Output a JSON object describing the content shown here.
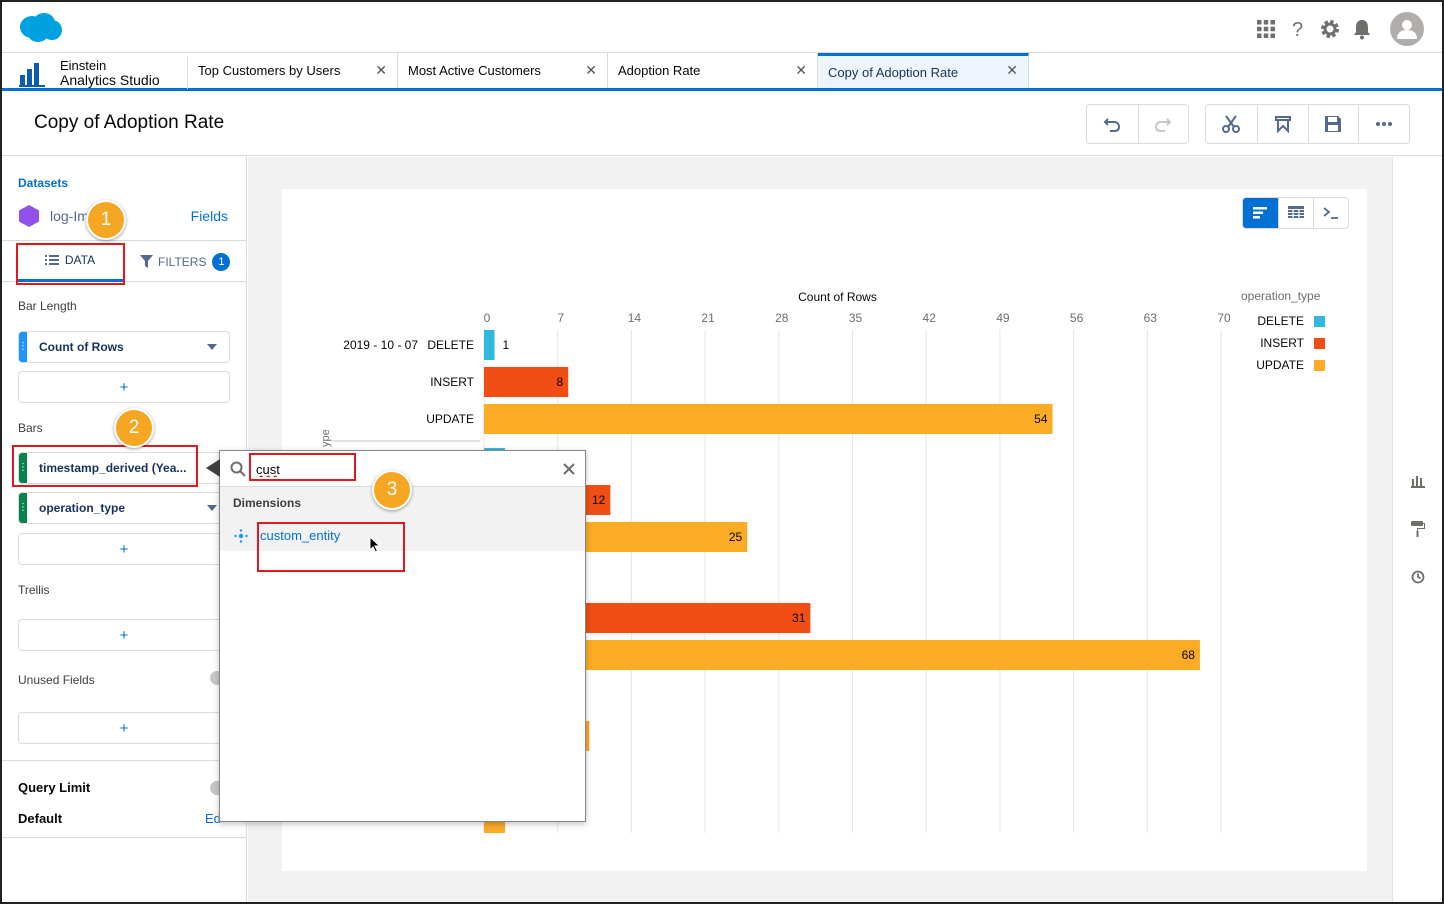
{
  "app": {
    "brand_line1": "Einstein",
    "brand_line2": "Analytics Studio"
  },
  "tabs": [
    {
      "label": "Top Customers by Users"
    },
    {
      "label": "Most Active Customers"
    },
    {
      "label": "Adoption Rate"
    },
    {
      "label": "Copy of Adoption Rate",
      "active": true
    }
  ],
  "page": {
    "title": "Copy of Adoption Rate"
  },
  "toolbar_icons": [
    "undo-icon",
    "redo-icon",
    "cut-icon",
    "clear-icon",
    "save-icon",
    "more-icon"
  ],
  "left_panel": {
    "datasets_label": "Datasets",
    "dataset_name": "log-Im",
    "fields_link": "Fields",
    "tab_data": "DATA",
    "tab_filters": "FILTERS",
    "filters_count": "1",
    "bar_length_label": "Bar Length",
    "bar_length_field": "Count of Rows",
    "bars_label": "Bars",
    "bars_fields": [
      "timestamp_derived (Yea...",
      "operation_type"
    ],
    "trellis_label": "Trellis",
    "unused_label": "Unused Fields",
    "add_symbol": "+",
    "query_limit_label": "Query Limit",
    "default_label": "Default",
    "edit_link": "Ed"
  },
  "search_dropdown": {
    "query": "cust",
    "section": "Dimensions",
    "result": "custom_entity"
  },
  "callouts": [
    "1",
    "2",
    "3"
  ],
  "colors": {
    "delete": "#31b8de",
    "insert": "#f04e14",
    "update": "#fcab24",
    "brand": "#0070d2",
    "callout": "#f5a623",
    "highlight": "#e0181f"
  },
  "chart_data": {
    "type": "bar",
    "orientation": "horizontal",
    "xlabel": "Count of Rows",
    "ylabel": "ype",
    "xlim": [
      0,
      70
    ],
    "x_ticks": [
      0,
      7,
      14,
      21,
      28,
      35,
      42,
      49,
      56,
      63,
      70
    ],
    "legend": {
      "title": "operation_type",
      "position": "top-right",
      "entries": [
        "DELETE",
        "INSERT",
        "UPDATE"
      ]
    },
    "groups": [
      {
        "label": "2019 - 10 - 07",
        "bars": [
          {
            "category": "DELETE",
            "value": 1
          },
          {
            "category": "INSERT",
            "value": 8
          },
          {
            "category": "UPDATE",
            "value": 54
          }
        ]
      },
      {
        "label": "",
        "bars": [
          {
            "category": "",
            "value": 2
          },
          {
            "category": "",
            "value": 12
          },
          {
            "category": "",
            "value": 25
          }
        ]
      },
      {
        "label": "",
        "bars": [
          {
            "category": "",
            "value": 31
          },
          {
            "category": "",
            "value": 68
          }
        ]
      },
      {
        "label": "",
        "bars": [
          {
            "category": "",
            "value": 10
          }
        ]
      },
      {
        "label": "",
        "bars": [
          {
            "category": "",
            "value": 2
          }
        ]
      }
    ],
    "visible_bars": [
      {
        "category": "DELETE",
        "value": 1,
        "label": "1"
      },
      {
        "category": "INSERT",
        "value": 8,
        "label": "8"
      },
      {
        "category": "UPDATE",
        "value": 54,
        "label": "54"
      },
      {
        "category": "DELETE",
        "value": 2,
        "label": ""
      },
      {
        "category": "INSERT",
        "value": 12,
        "label": "12"
      },
      {
        "category": "UPDATE",
        "value": 25,
        "label": "25"
      },
      {
        "category": "INSERT",
        "value": 31,
        "label": "31"
      },
      {
        "category": "UPDATE",
        "value": 68,
        "label": "68"
      },
      {
        "category": "UPDATE",
        "value": 10,
        "label": ""
      },
      {
        "category": "UPDATE",
        "value": 2,
        "label": ""
      }
    ]
  }
}
